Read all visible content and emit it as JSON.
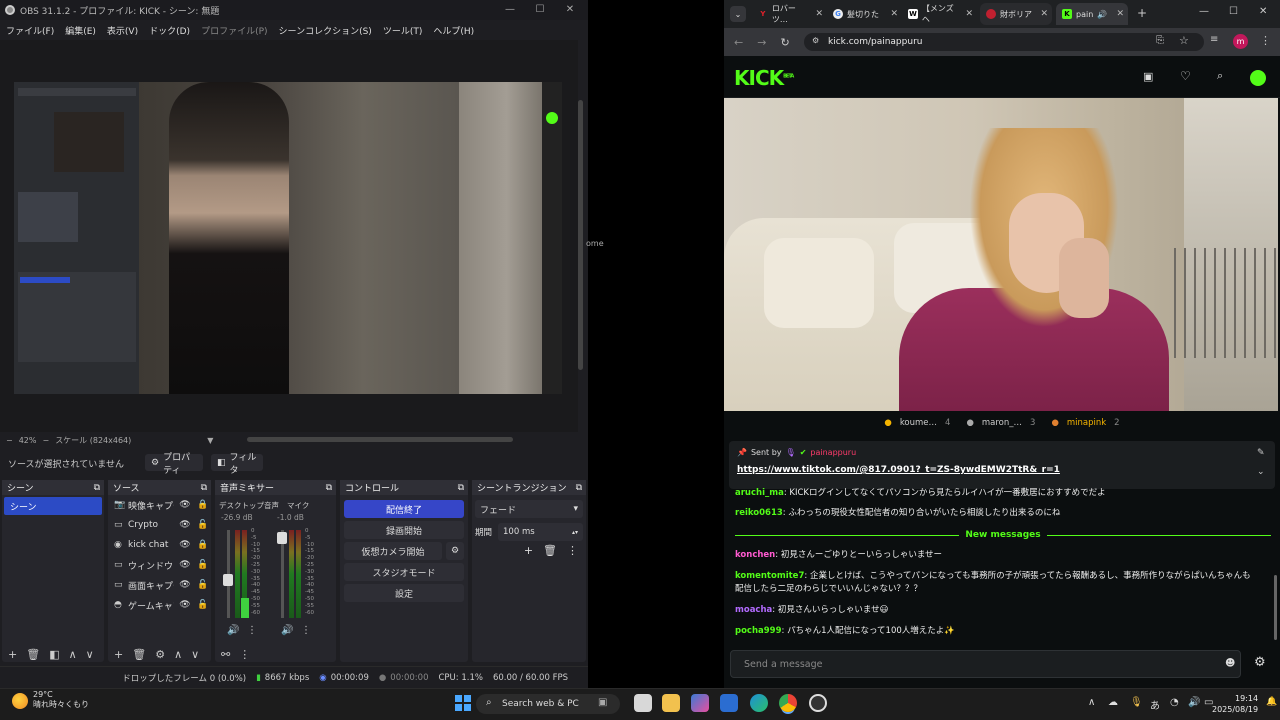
{
  "obs": {
    "title": "OBS 31.1.2 - プロファイル: KICK - シーン: 無題",
    "menu": [
      "ファイル(F)",
      "編集(E)",
      "表示(V)",
      "ドック(D)",
      "プロファイル(P)",
      "シーンコレクション(S)",
      "ツール(T)",
      "ヘルプ(H)"
    ],
    "zoom": "42%",
    "scale": "スケール (824x464)",
    "no_source": "ソースが選択されていません",
    "properties": "プロパティ",
    "filters": "フィルタ",
    "docks": {
      "scenes": "シーン",
      "sources": "ソース",
      "mixer": "音声ミキサー",
      "controls": "コントロール",
      "transitions": "シーントランジション"
    },
    "scene_selected": "シーン",
    "sources": [
      {
        "icon": "camera-icon",
        "glyph": "📷",
        "name": "映像キャプチ"
      },
      {
        "icon": "browser-icon",
        "glyph": "▭",
        "name": "Crypto"
      },
      {
        "icon": "globe-icon",
        "glyph": "◉",
        "name": "kick chat"
      },
      {
        "icon": "window-icon",
        "glyph": "▭",
        "name": "ウィンドウキャ"
      },
      {
        "icon": "monitor-icon",
        "glyph": "▭",
        "name": "画面キャプチ"
      },
      {
        "icon": "gamepad-icon",
        "glyph": "◓",
        "name": "ゲームキャプ"
      }
    ],
    "mixer": {
      "ch1_name": "デスクトップ音声",
      "ch1_db": "-26.9 dB",
      "ch2_name": "マイク",
      "ch2_db": "-1.0 dB",
      "scale": [
        "0",
        "-5",
        "-10",
        "-15",
        "-20",
        "-25",
        "-30",
        "-35",
        "-40",
        "-45",
        "-50",
        "-55",
        "-60"
      ]
    },
    "controls": {
      "stop_stream": "配信終了",
      "start_record": "録画開始",
      "virtual_cam": "仮想カメラ開始",
      "studio_mode": "スタジオモード",
      "settings": "設定"
    },
    "transition": {
      "type": "フェード",
      "duration_label": "期間",
      "duration": "100 ms"
    },
    "status": {
      "dropped": "ドロップしたフレーム 0 (0.0%)",
      "kbps": "8667 kbps",
      "stream_time": "00:00:09",
      "rec_time": "00:00:00",
      "cpu": "CPU: 1.1%",
      "fps": "60.00 / 60.00 FPS"
    },
    "accent": "#3646c8"
  },
  "middle_text": "ome",
  "browser": {
    "tabs": [
      {
        "label": "ロバーツ…",
        "fav": "Y",
        "color": "#e0202a"
      },
      {
        "label": "髪切りた",
        "fav": "G",
        "color": "#eee"
      },
      {
        "label": "【メンズヘ",
        "fav": "W",
        "color": "#fff"
      },
      {
        "label": "財ボリア",
        "fav": "",
        "color": "#c02030"
      },
      {
        "label": "pain",
        "fav": "K",
        "color": "#53fc18"
      }
    ],
    "url": "kick.com/painappuru",
    "profile_letter": "m"
  },
  "kick": {
    "logo": "KICK",
    "logo_beta": "BETA",
    "accent": "#53fc18",
    "viewers": [
      {
        "name": "koume…",
        "count": "4"
      },
      {
        "name": "maron_…",
        "count": "3"
      },
      {
        "name": "minapink",
        "count": "2"
      }
    ],
    "pinned_label": "Sent by",
    "pinned_user": "painappuru",
    "pinned_link": "https://www.tiktok.com/@817.0901?_t=ZS-8ywdEMW2TtR&_r=1",
    "messages": [
      {
        "user": "aruchi_ma",
        "color": "#53fc18",
        "text": "KICKログインしてなくてパソコンから見たらルイハイが一番敷居におすすめでだよ"
      },
      {
        "user": "reiko0613",
        "color": "#53fc18",
        "text": "ふわっちの現役女性配信者の知り合いがいたら相談したり出来るのにね"
      },
      {
        "user": "konchen",
        "color": "#ff5bd0",
        "text": "初見さんーごゆりとーいらっしゃいませー"
      },
      {
        "user": "komentomite7",
        "color": "#53fc18",
        "text": "企業しとけば、こうやってパンになっても事務所の子が頑張ってたら報酬あるし、事務所作りながらぱいんちゃんも配信したら二足のわらじでいいんじゃない？？？"
      },
      {
        "user": "moacha",
        "color": "#b36bff",
        "text": "初見さんいらっしゃいませ😃"
      },
      {
        "user": "pocha999",
        "color": "#53fc18",
        "text": "パちゃん1人配信になって100人増えたよ✨"
      }
    ],
    "new_messages": "New messages",
    "send_placeholder": "Send a message"
  },
  "taskbar": {
    "temp": "29°C",
    "weather": "晴れ時々くもり",
    "search": "Search web & PC",
    "time": "19:14",
    "date": "2025/08/19",
    "ime": "あ"
  }
}
